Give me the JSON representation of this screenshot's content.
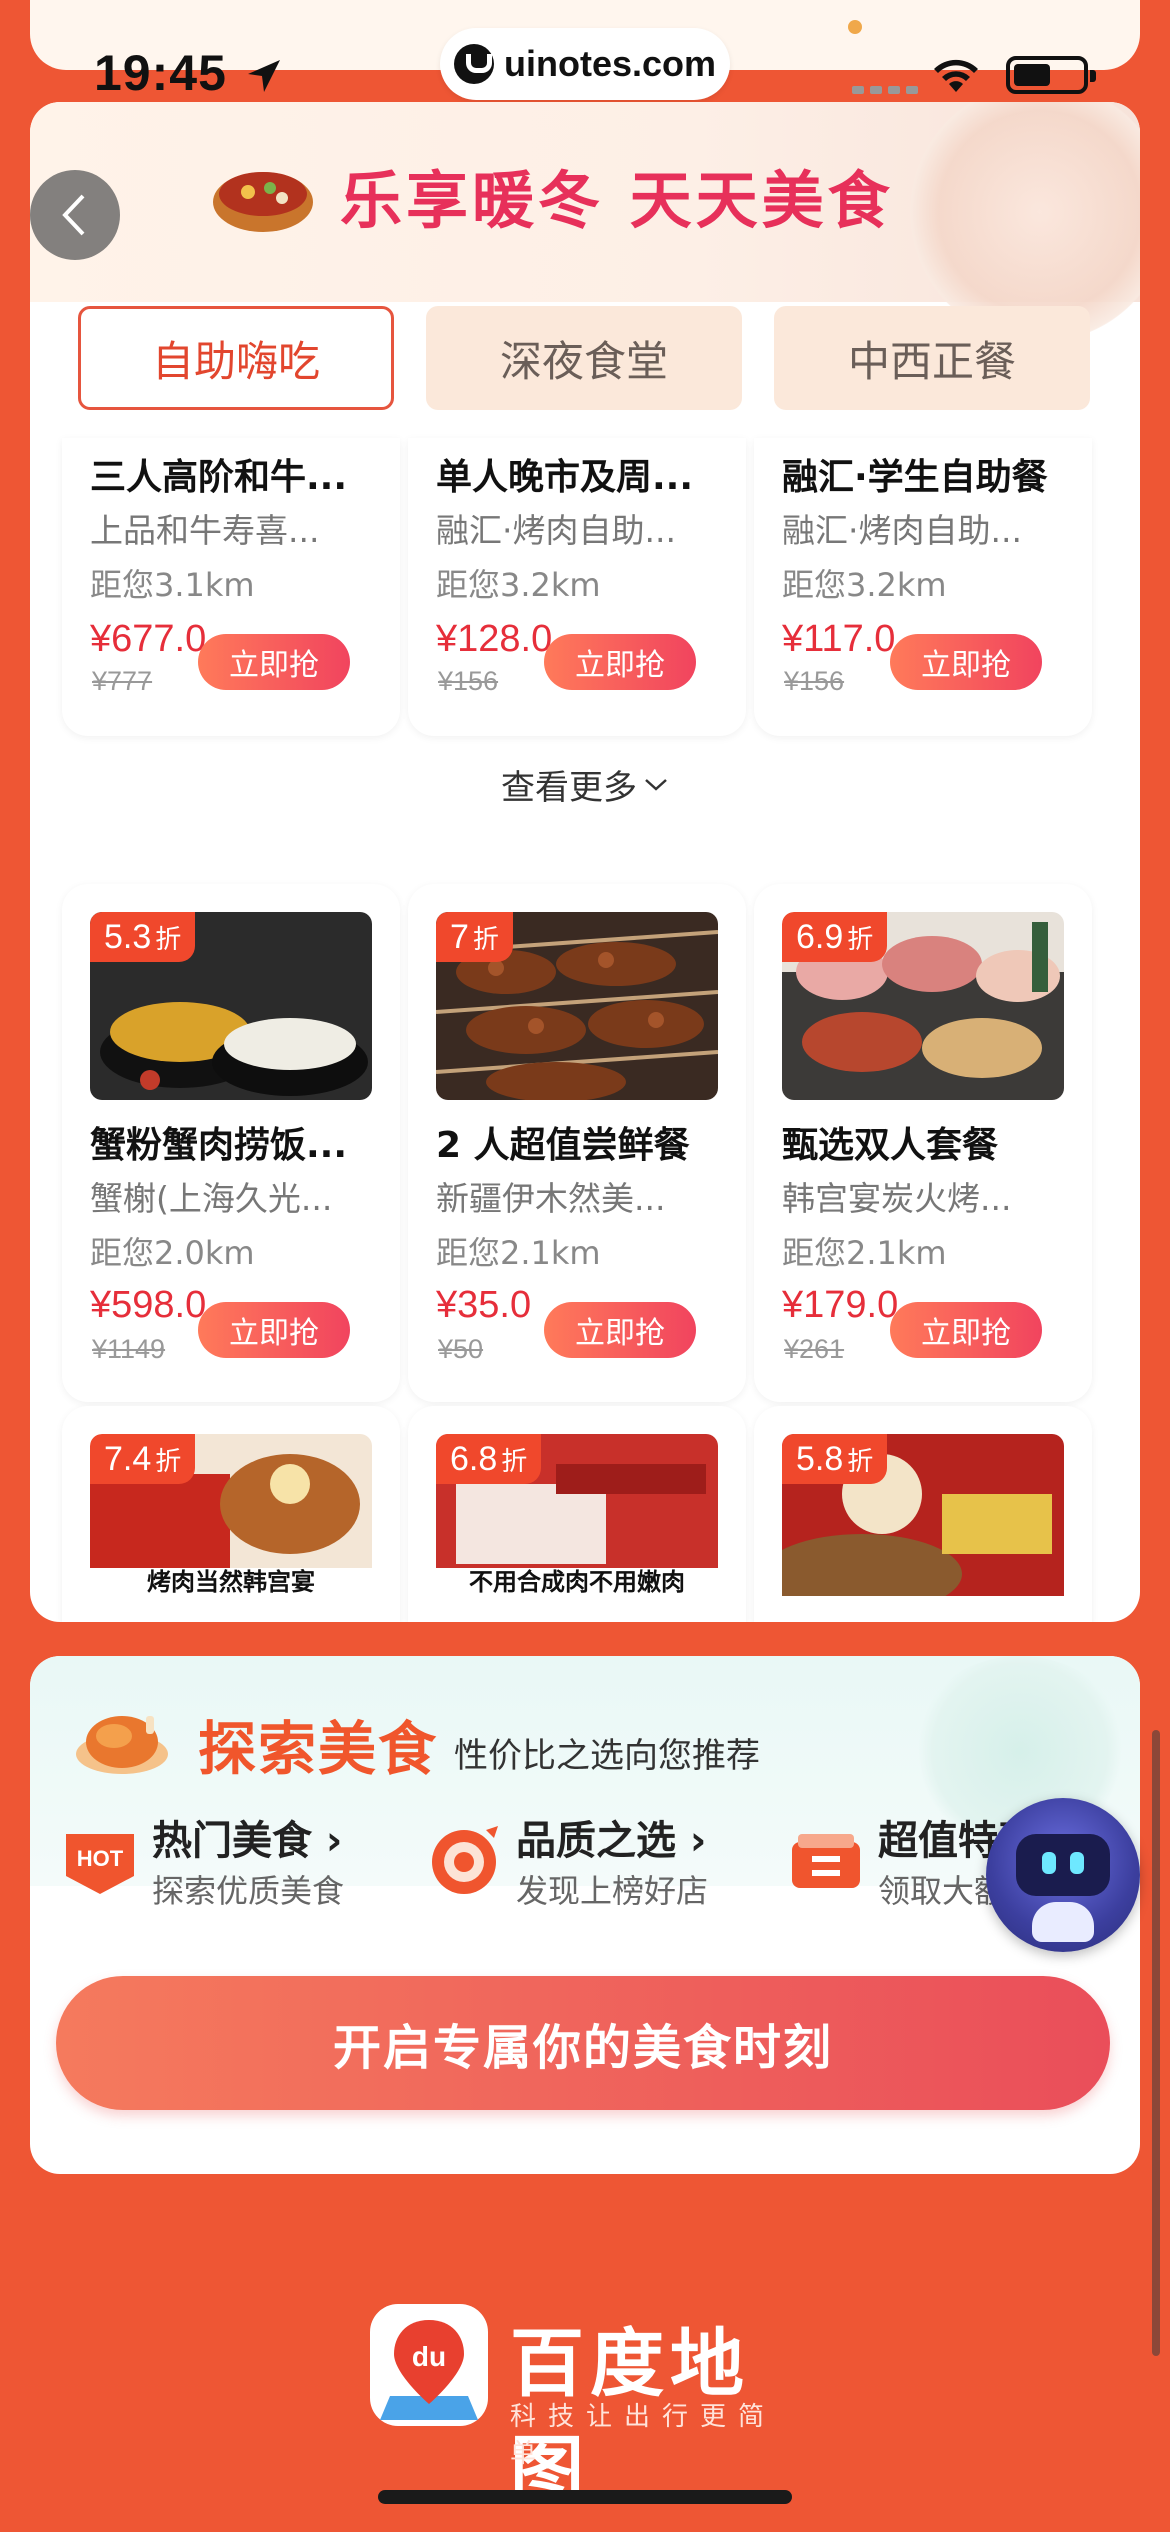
{
  "status_bar": {
    "time": "19:45",
    "url": "uinotes.com"
  },
  "banner": {
    "title": "乐享暖冬 天天美食"
  },
  "tabs": [
    {
      "label": "自助嗨吃"
    },
    {
      "label": "深夜食堂"
    },
    {
      "label": "中西正餐"
    }
  ],
  "row1": [
    {
      "title": "三人高阶和牛...",
      "shop": "上品和牛寿喜...",
      "distance": "距您3.1km",
      "price": "¥677.0",
      "orig_price": "¥777",
      "button": "立即抢"
    },
    {
      "title": "单人晚市及周...",
      "shop": "融汇·烤肉自助...",
      "distance": "距您3.2km",
      "price": "¥128.0",
      "orig_price": "¥156",
      "button": "立即抢"
    },
    {
      "title": "融汇·学生自助餐",
      "shop": "融汇·烤肉自助...",
      "distance": "距您3.2km",
      "price": "¥117.0",
      "orig_price": "¥156",
      "button": "立即抢"
    }
  ],
  "see_more": "查看更多",
  "row2": [
    {
      "discount": "5.3",
      "unit": "折",
      "title": "蟹粉蟹肉捞饭...",
      "shop": "蟹榭(上海久光...",
      "distance": "距您2.0km",
      "price": "¥598.0",
      "orig_price": "¥1149",
      "button": "立即抢"
    },
    {
      "discount": "7",
      "unit": "折",
      "title": "2 人超值尝鲜餐",
      "shop": "新疆伊木然美...",
      "distance": "距您2.1km",
      "price": "¥35.0",
      "orig_price": "¥50",
      "button": "立即抢"
    },
    {
      "discount": "6.9",
      "unit": "折",
      "title": "甄选双人套餐",
      "shop": "韩宫宴炭火烤...",
      "distance": "距您2.1km",
      "price": "¥179.0",
      "orig_price": "¥261",
      "button": "立即抢"
    }
  ],
  "row3": [
    {
      "discount": "7.4",
      "unit": "折",
      "img_text": "烤肉当然韩宫宴"
    },
    {
      "discount": "6.8",
      "unit": "折",
      "img_text": "不用合成肉不用嫩肉"
    },
    {
      "discount": "5.8",
      "unit": "折",
      "img_text": ""
    }
  ],
  "explore": {
    "title": "探索美食",
    "subtitle": "性价比之选向您推荐",
    "categories": [
      {
        "title": "热门美食",
        "subtitle": "探索优质美食",
        "icon": "hot-icon",
        "icon_text": "HOT"
      },
      {
        "title": "品质之选",
        "subtitle": "发现上榜好店",
        "icon": "target-icon"
      },
      {
        "title": "超值特惠",
        "subtitle": "领取大额",
        "icon": "coupon-icon"
      }
    ],
    "cta": "开启专属你的美食时刻"
  },
  "footer": {
    "logo_text": "百度地图",
    "logo_badge": "du",
    "slogan": "科技让出行更简单"
  },
  "colors": {
    "background": "#EE5634",
    "accent": "#E2462E",
    "price": "#E62E3A"
  }
}
